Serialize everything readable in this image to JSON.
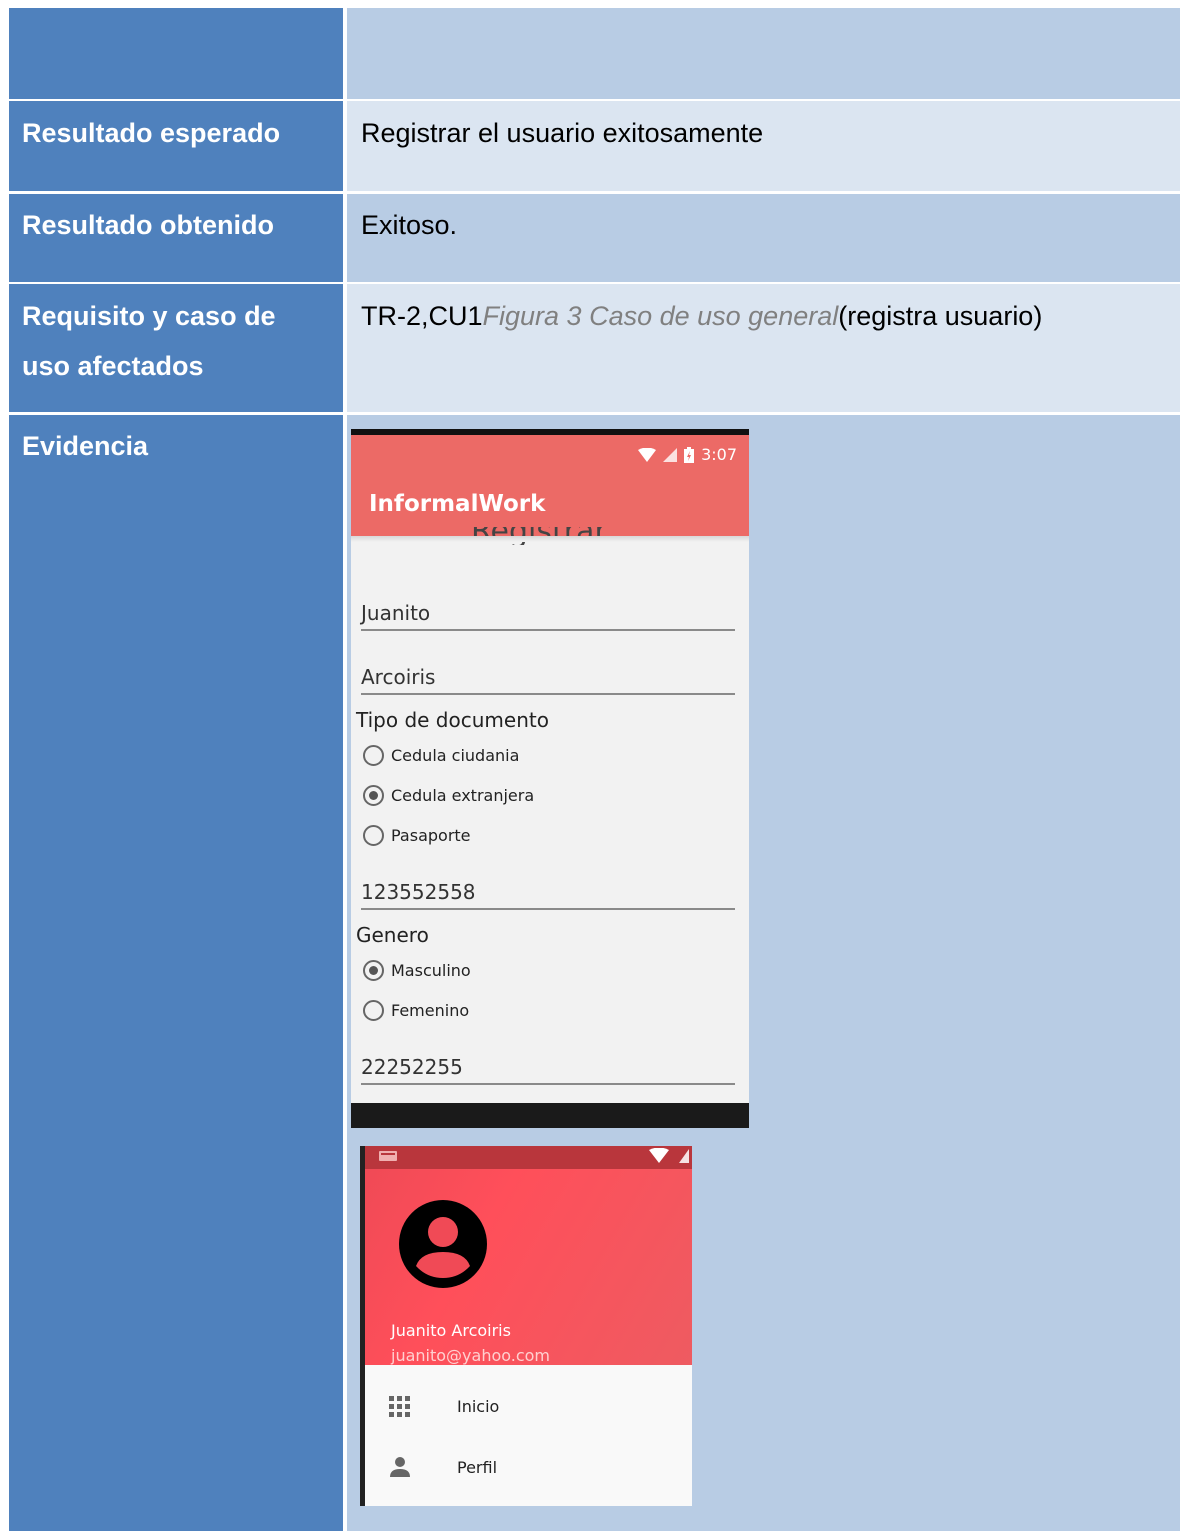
{
  "rows": {
    "expected_label": "Resultado esperado",
    "expected_value": "Registrar el usuario exitosamente",
    "obtained_label": "Resultado obtenido",
    "obtained_value": "Exitoso.",
    "req_label_line1": "Requisito y caso de",
    "req_label_line2": "uso afectados",
    "req_value_prefix": "TR-2,CU1",
    "req_value_figure": "Figura 3 Caso de uso general",
    "req_value_suffix": "(registra usuario)",
    "evidence_label": "Evidencia"
  },
  "phone1": {
    "time": "3:07",
    "app_title": "InformalWork",
    "partial_heading": "Registrar",
    "first_name": "Juanito",
    "last_name": "Arcoiris",
    "doc_type_label": "Tipo de documento",
    "doc_options": [
      "Cedula ciudania",
      "Cedula extranjera",
      "Pasaporte"
    ],
    "doc_selected": "Cedula extranjera",
    "doc_number": "123552558",
    "gender_label": "Genero",
    "gender_options": [
      "Masculino",
      "Femenino"
    ],
    "gender_selected": "Masculino",
    "phone_number": "22252255"
  },
  "phone2": {
    "user_name": "Juanito Arcoiris",
    "user_email": "juanito@yahoo.com",
    "menu": [
      {
        "label": "Inicio",
        "icon": "grid-icon"
      },
      {
        "label": "Perfil",
        "icon": "person-icon"
      }
    ]
  },
  "colors": {
    "label_bg": "#4f81bd",
    "value_dark": "#b8cce4",
    "value_light": "#dbe5f1",
    "app_bar": "#ec6a66",
    "drawer_header": "#ff4f5a"
  }
}
